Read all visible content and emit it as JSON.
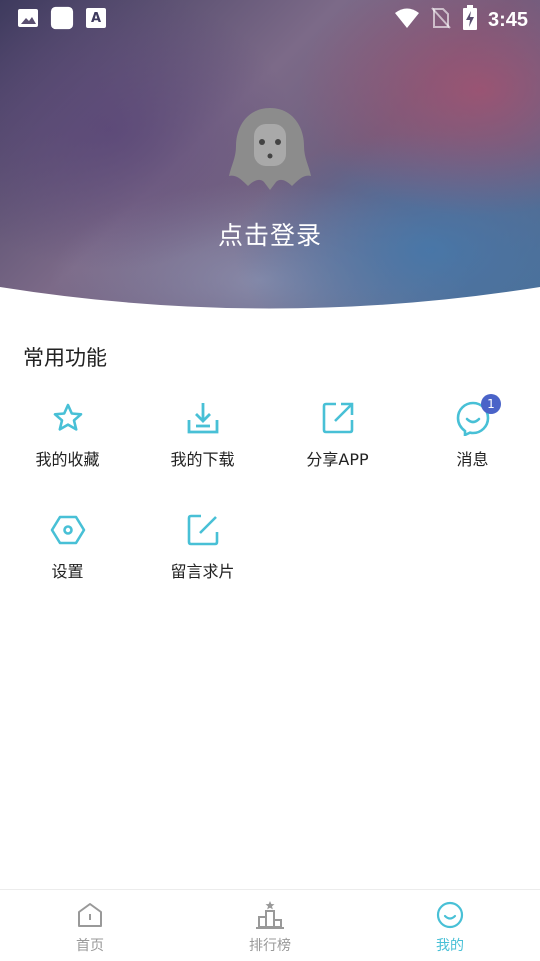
{
  "status_bar": {
    "time": "3:45",
    "left_icons": [
      "image-icon",
      "app-icon",
      "text-a-icon"
    ],
    "right_icons": [
      "wifi-icon",
      "no-sim-icon",
      "battery-charging-icon"
    ]
  },
  "profile": {
    "login_label": "点击登录",
    "avatar_icon": "ghost-avatar-icon"
  },
  "section": {
    "title": "常用功能"
  },
  "functions": [
    {
      "label": "我的收藏",
      "icon": "star-icon"
    },
    {
      "label": "我的下载",
      "icon": "download-icon"
    },
    {
      "label": "分享APP",
      "icon": "share-icon"
    },
    {
      "label": "消息",
      "icon": "message-icon",
      "badge": "1"
    },
    {
      "label": "设置",
      "icon": "settings-icon"
    },
    {
      "label": "留言求片",
      "icon": "edit-icon"
    }
  ],
  "tabs": [
    {
      "label": "首页",
      "icon": "home-icon",
      "active": false
    },
    {
      "label": "排行榜",
      "icon": "ranking-icon",
      "active": false
    },
    {
      "label": "我的",
      "icon": "smile-icon",
      "active": true
    }
  ],
  "colors": {
    "accent": "#48c0d6",
    "badge": "#4a63c8",
    "inactive": "#999999"
  }
}
